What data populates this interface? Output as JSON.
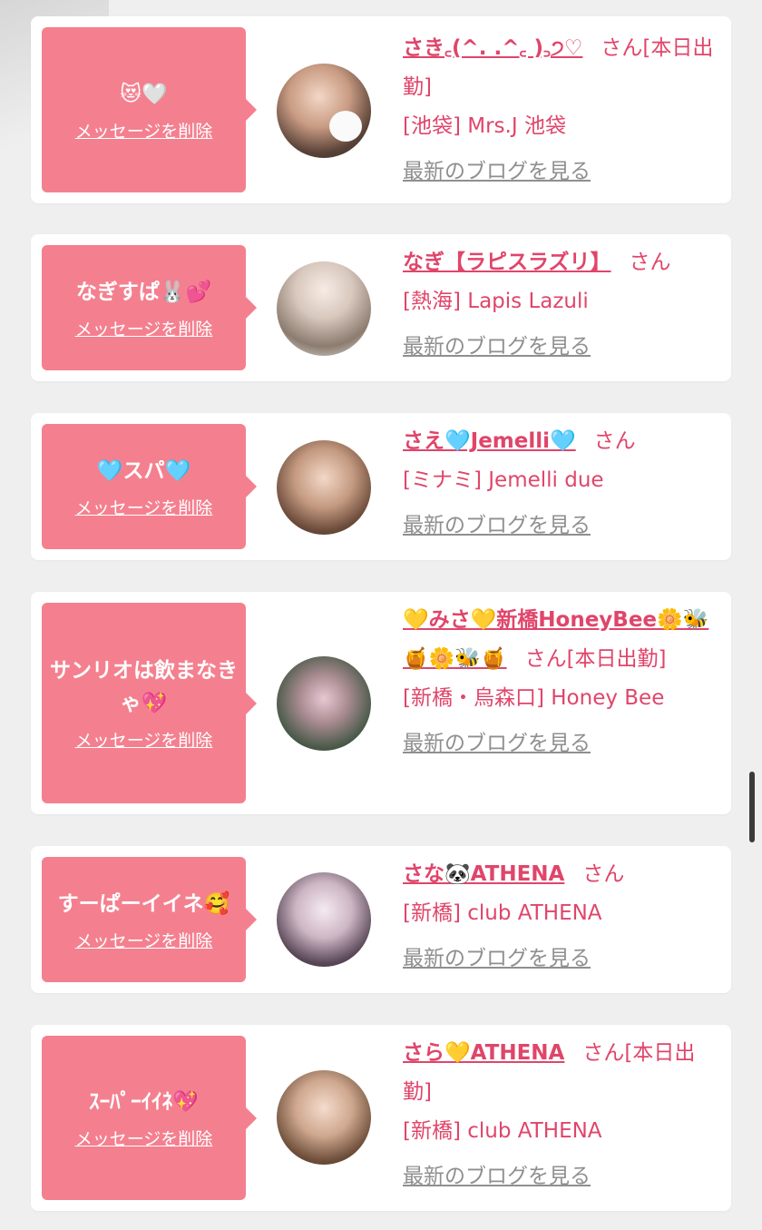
{
  "common": {
    "delete_label": "メッセージを削除",
    "blog_label": "最新のブログを見る",
    "san_suffix": "さん"
  },
  "items": [
    {
      "message": "😻🤍",
      "name": "さき꜀(^. .^꜀ )꜆੭♡",
      "status": "[本日出勤]",
      "shop": "[池袋] Mrs.J 池袋"
    },
    {
      "message": "なぎすぱ🐰💕",
      "name": "なぎ【ラピスラズリ】",
      "status": "",
      "shop": "[熱海] Lapis Lazuli"
    },
    {
      "message": "🩵スパ🩵",
      "name": "さえ🩵Jemelli🩵",
      "status": "",
      "shop": "[ミナミ] Jemelli due"
    },
    {
      "message": "サンリオは飲まなきゃ💖",
      "name": "💛みさ💛新橋HoneyBee🌼🐝🍯🌼🐝🍯",
      "status": "[本日出勤]",
      "shop": "[新橋・烏森口] Honey Bee"
    },
    {
      "message": "すーぱーイイネ🥰",
      "name": "さな🐼ATHENA",
      "status": "",
      "shop": "[新橋] club ATHENA"
    },
    {
      "message": "ｽｰﾊﾟｰｲｲﾈ💖",
      "name": "さら💛ATHENA",
      "status": "[本日出勤]",
      "shop": "[新橋] club ATHENA"
    }
  ],
  "colors": {
    "accent_pink": "#f4808f",
    "link_pink": "#e0456a",
    "gray_link": "#8f8f8f",
    "background": "#efefef"
  }
}
